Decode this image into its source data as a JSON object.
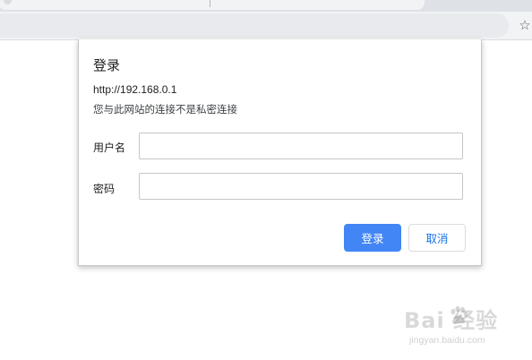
{
  "browser": {
    "star_icon": "star-icon"
  },
  "dialog": {
    "title": "登录",
    "url": "http://192.168.0.1",
    "warning": "您与此网站的连接不是私密连接",
    "username_label": "用户名",
    "username_value": "",
    "password_label": "密码",
    "password_value": "",
    "login_button": "登录",
    "cancel_button": "取消",
    "primary_color": "#4285f4"
  },
  "watermark": {
    "brand": "Bai 经验",
    "site": "jingyan.baidu.com"
  }
}
